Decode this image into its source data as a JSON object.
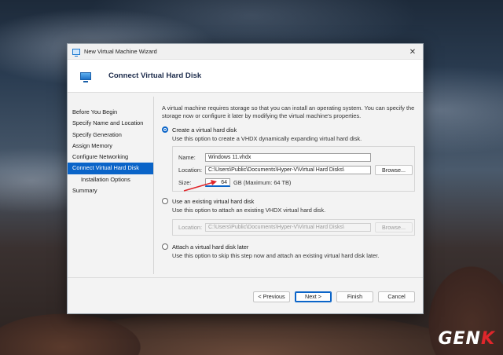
{
  "window": {
    "title": "New Virtual Machine Wizard",
    "close_glyph": "✕",
    "header_title": "Connect Virtual Hard Disk"
  },
  "nav": {
    "items": [
      {
        "label": "Before You Begin"
      },
      {
        "label": "Specify Name and Location"
      },
      {
        "label": "Specify Generation"
      },
      {
        "label": "Assign Memory"
      },
      {
        "label": "Configure Networking"
      },
      {
        "label": "Connect Virtual Hard Disk",
        "active": true
      },
      {
        "label": "Installation Options",
        "sub": true
      },
      {
        "label": "Summary"
      }
    ]
  },
  "content": {
    "intro": "A virtual machine requires storage so that you can install an operating system. You can specify the storage now or configure it later by modifying the virtual machine's properties.",
    "option_create": {
      "label": "Create a virtual hard disk",
      "selected": true,
      "desc": "Use this option to create a VHDX dynamically expanding virtual hard disk.",
      "name_label": "Name:",
      "name_value": "Windows 11.vhdx",
      "location_label": "Location:",
      "location_value": "C:\\Users\\Public\\Documents\\Hyper-V\\Virtual Hard Disks\\",
      "browse_label": "Browse...",
      "size_label": "Size:",
      "size_value": "64",
      "size_suffix": "GB (Maximum: 64 TB)"
    },
    "option_existing": {
      "label": "Use an existing virtual hard disk",
      "selected": false,
      "desc": "Use this option to attach an existing VHDX virtual hard disk.",
      "location_label": "Location:",
      "location_value": "C:\\Users\\Public\\Documents\\Hyper-V\\Virtual Hard Disks\\",
      "browse_label": "Browse..."
    },
    "option_later": {
      "label": "Attach a virtual hard disk later",
      "selected": false,
      "desc": "Use this option to skip this step now and attach an existing virtual hard disk later."
    }
  },
  "footer": {
    "previous": "< Previous",
    "next": "Next >",
    "finish": "Finish",
    "cancel": "Cancel"
  },
  "watermark": {
    "text_a": "GEN",
    "text_b": "K"
  },
  "colors": {
    "accent": "#0a64c8",
    "annotation_arrow": "#e0262b"
  }
}
